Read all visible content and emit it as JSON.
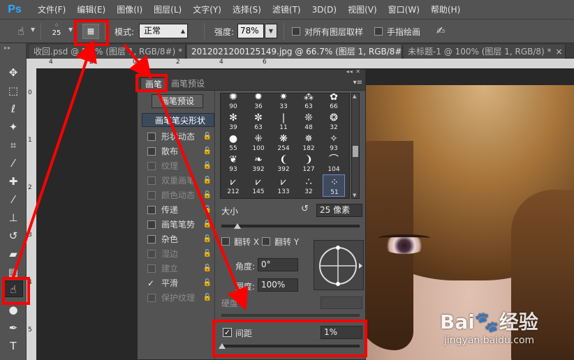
{
  "app": {
    "logo": "Ps"
  },
  "menubar": {
    "items": [
      "文件(F)",
      "编辑(E)",
      "图像(I)",
      "图层(L)",
      "文字(Y)",
      "选择(S)",
      "滤镜(T)",
      "3D(D)",
      "视图(V)",
      "窗口(W)",
      "帮助(H)"
    ]
  },
  "options": {
    "tool_icon": "smudge-tool-icon",
    "brush_size": "25",
    "mode_label": "模式:",
    "mode_value": "正常",
    "strength_label": "强度:",
    "strength_value": "78%",
    "sample_all_label": "对所有图层取样",
    "finger_paint_label": "手指绘画"
  },
  "tabs": [
    {
      "label": "收回.psd @ 5...% (图层 1, RGB/8#) *",
      "close": "×"
    },
    {
      "label": "20120212001251​49.jpg @ 66.7% (图层 1, RGB/8#) *",
      "close": "×"
    },
    {
      "label": "未标题-1 @ 100% (图层 1, RGB/8) *",
      "close": "×"
    }
  ],
  "ruler": {
    "top_ticks": [
      "4",
      "2",
      "0",
      "2",
      "4",
      "6"
    ],
    "left_ticks": [
      "0",
      "1",
      "2",
      "3",
      "4",
      "5"
    ]
  },
  "brush_panel": {
    "tabs": [
      "画笔",
      "画笔预设"
    ],
    "presets_button": "画笔预设",
    "options": [
      {
        "label": "画笔笔尖形状",
        "selected": true,
        "has_checkbox": false,
        "enabled": true
      },
      {
        "label": "形状动态",
        "checked": false,
        "enabled": true,
        "lock": true
      },
      {
        "label": "散布",
        "checked": false,
        "enabled": true,
        "lock": true
      },
      {
        "label": "纹理",
        "checked": false,
        "enabled": false,
        "lock": true
      },
      {
        "label": "双重画笔",
        "checked": false,
        "enabled": false,
        "lock": true
      },
      {
        "label": "颜色动态",
        "checked": false,
        "enabled": false,
        "lock": true
      },
      {
        "label": "传递",
        "checked": false,
        "enabled": true,
        "lock": true
      },
      {
        "label": "画笔笔势",
        "checked": false,
        "enabled": true,
        "lock": true
      },
      {
        "label": "杂色",
        "checked": false,
        "enabled": true,
        "lock": true
      },
      {
        "label": "湿边",
        "checked": false,
        "enabled": false,
        "lock": true
      },
      {
        "label": "建立",
        "checked": false,
        "enabled": false,
        "lock": true
      },
      {
        "label": "平滑",
        "checked": true,
        "enabled": true,
        "lock": true
      },
      {
        "label": "保护纹理",
        "checked": false,
        "enabled": false,
        "lock": true
      }
    ],
    "brush_grid": [
      [
        "90",
        "36",
        "33",
        "63",
        "66"
      ],
      [
        "39",
        "63",
        "11",
        "48",
        "32"
      ],
      [
        "55",
        "100",
        "254",
        "182",
        "93"
      ],
      [
        "93",
        "392",
        "392",
        "127",
        "104"
      ],
      [
        "212",
        "145",
        "133",
        "32",
        "51"
      ]
    ],
    "selected_brush": "51",
    "size_label": "大小",
    "size_value": "25 像素",
    "flip_x_label": "翻转 X",
    "flip_y_label": "翻转 Y",
    "angle_label": "角度:",
    "angle_value": "0°",
    "roundness_label": "圆度:",
    "roundness_value": "100%",
    "hardness_label": "硬度",
    "spacing_label": "间距",
    "spacing_checked": "✓",
    "spacing_value": "1%"
  },
  "watermark": {
    "logo": "Bai🐾经验",
    "url": "jingyan.baidu.com"
  },
  "colors": {
    "annotation": "#ff0000",
    "ps_blue": "#31a8ff"
  }
}
